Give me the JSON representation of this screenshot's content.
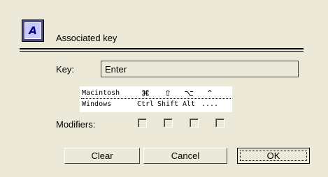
{
  "header": {
    "icon_letter": "A",
    "title": "Associated key"
  },
  "key": {
    "label": "Key:",
    "value": "Enter"
  },
  "modifier_table": {
    "mac": {
      "name": "Macintosh",
      "keys": [
        "⌘",
        "⇧",
        "⌥",
        "⌃"
      ]
    },
    "windows": {
      "name": "Windows",
      "keys": [
        "Ctrl",
        "Shift",
        "Alt",
        "...."
      ]
    }
  },
  "modifiers": {
    "label": "Modifiers:",
    "checked": [
      false,
      false,
      false,
      false
    ]
  },
  "buttons": {
    "clear": "Clear",
    "cancel": "Cancel",
    "ok": "OK"
  }
}
